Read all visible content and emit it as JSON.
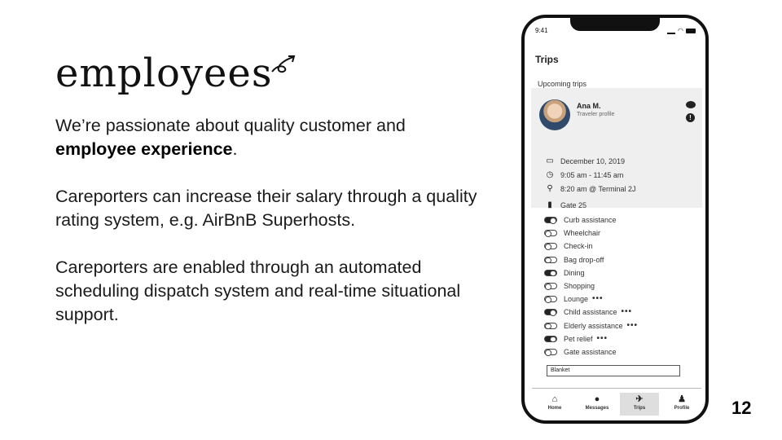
{
  "slide": {
    "logo_text": "employees",
    "paragraph1_a": "We’re passionate about quality customer and",
    "paragraph1_b_bold": "employee experience",
    "paragraph1_c": ".",
    "paragraph2": "Careporters can increase their salary through a quality rating system, e.g. AirBnB Superhosts.",
    "paragraph3": "Careporters are enabled through an automated scheduling dispatch system and real-time situational support.",
    "page_number": "12"
  },
  "phone": {
    "status_time": "9:41",
    "title": "Trips",
    "section_label": "Upcoming trips",
    "traveler": {
      "name": "Ana M.",
      "role": "Traveler profile"
    },
    "details": [
      {
        "icon": "calendar-icon",
        "text": "December 10, 2019"
      },
      {
        "icon": "clock-icon",
        "text": "9:05 am - 11:45 am"
      },
      {
        "icon": "location-pin-icon",
        "text": "8:20 am @ Terminal 2J"
      },
      {
        "icon": "bookmark-icon",
        "text": "Gate 25"
      }
    ],
    "options": [
      {
        "label": "Curb assistance",
        "on": true,
        "more": false
      },
      {
        "label": "Wheelchair",
        "on": false,
        "more": false
      },
      {
        "label": "Check-in",
        "on": false,
        "more": false
      },
      {
        "label": "Bag drop-off",
        "on": false,
        "more": false
      },
      {
        "label": "Dining",
        "on": true,
        "more": false
      },
      {
        "label": "Shopping",
        "on": false,
        "more": false
      },
      {
        "label": "Lounge",
        "on": false,
        "more": true
      },
      {
        "label": "Child assistance",
        "on": true,
        "more": true
      },
      {
        "label": "Elderly assistance",
        "on": false,
        "more": true
      },
      {
        "label": "Pet relief",
        "on": true,
        "more": true
      },
      {
        "label": "Gate assistance",
        "on": false,
        "more": false
      }
    ],
    "more_dots": "•••",
    "notes_field_value": "Blanket",
    "tabs": [
      {
        "label": "Home",
        "icon": "home-icon",
        "glyph": "⌂",
        "active": false
      },
      {
        "label": "Messages",
        "icon": "chat-bubble-icon",
        "glyph": "●",
        "active": false
      },
      {
        "label": "Trips",
        "icon": "airplane-icon",
        "glyph": "✈",
        "active": true
      },
      {
        "label": "Profile",
        "icon": "person-icon",
        "glyph": "♟",
        "active": false
      }
    ]
  }
}
